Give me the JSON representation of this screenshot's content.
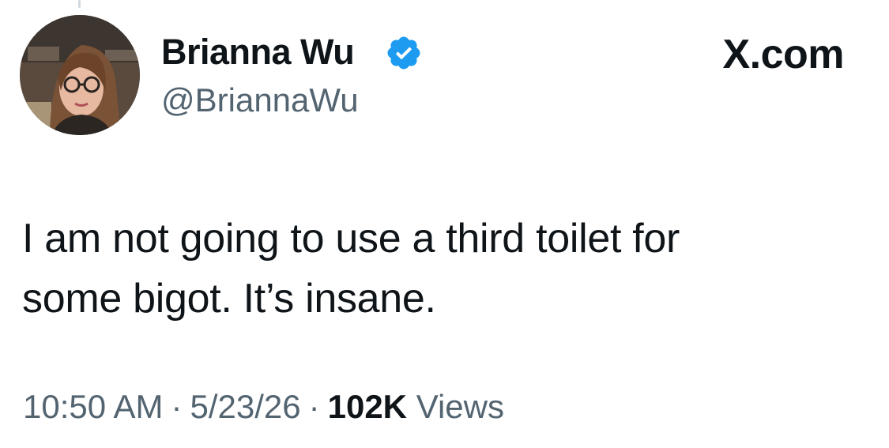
{
  "tweet": {
    "author": {
      "display_name": "Brianna Wu",
      "handle": "@BriannaWu",
      "verified": true,
      "verified_color": "#1d9bf0"
    },
    "brand": "X.com",
    "text_lines": [
      "I am not going to use a third toilet for",
      "some bigot. It’s insane."
    ],
    "time": "10:50 AM",
    "date": "5/23/26",
    "separator": "·",
    "views_count": "102K",
    "views_label": "Views"
  },
  "icons": {
    "avatar": "user-avatar-photo",
    "verified": "verified-badge-icon"
  }
}
